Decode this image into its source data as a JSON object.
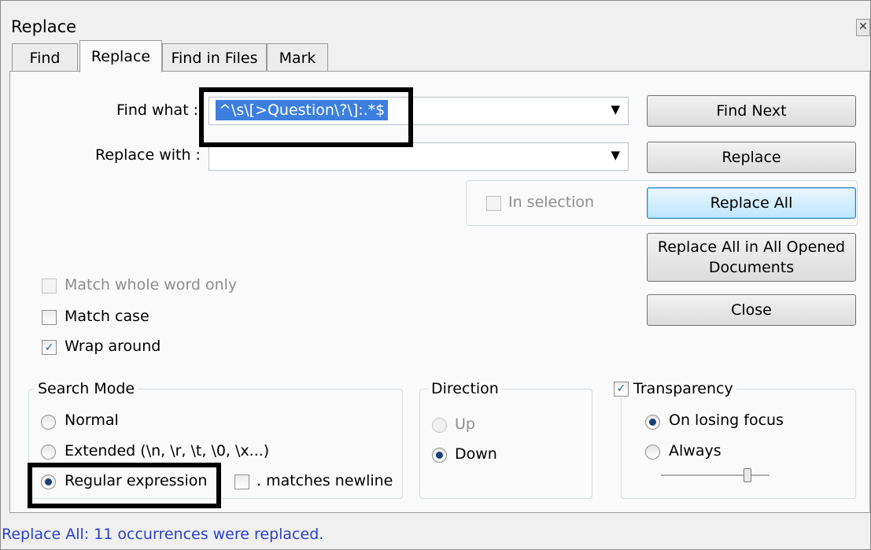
{
  "window": {
    "title": "Replace",
    "close_glyph": "✕"
  },
  "tabs": [
    {
      "label": "Find",
      "active": false
    },
    {
      "label": "Replace",
      "active": true
    },
    {
      "label": "Find in Files",
      "active": false
    },
    {
      "label": "Mark",
      "active": false
    }
  ],
  "find": {
    "label": "Find what :",
    "value": "^\\s\\[>Question\\?\\]:.*$"
  },
  "replace": {
    "label": "Replace with :",
    "value": ""
  },
  "in_selection": {
    "label": "In selection",
    "checked": false,
    "enabled": false
  },
  "buttons": {
    "find_next": "Find Next",
    "replace": "Replace",
    "replace_all": "Replace All",
    "replace_all_opened_line1": "Replace All in All Opened",
    "replace_all_opened_line2": "Documents",
    "close": "Close"
  },
  "options": {
    "match_whole_word": {
      "label": "Match whole word only",
      "checked": false,
      "enabled": false
    },
    "match_case": {
      "label": "Match case",
      "checked": false
    },
    "wrap_around": {
      "label": "Wrap around",
      "checked": true
    }
  },
  "search_mode": {
    "legend": "Search Mode",
    "normal": "Normal",
    "extended": "Extended (\\n, \\r, \\t, \\0, \\x...)",
    "regex": "Regular expression",
    "matches_newline": ". matches newline",
    "selected": "regex"
  },
  "direction": {
    "legend": "Direction",
    "up": "Up",
    "down": "Down",
    "selected": "down"
  },
  "transparency": {
    "legend": "Transparency",
    "checked": true,
    "on_losing_focus": "On losing focus",
    "always": "Always",
    "selected": "on_losing_focus",
    "slider_level": 0.8
  },
  "status": "Replace All: 11 occurrences were replaced.",
  "glyphs": {
    "check": "✓",
    "dropdown": "▼"
  }
}
